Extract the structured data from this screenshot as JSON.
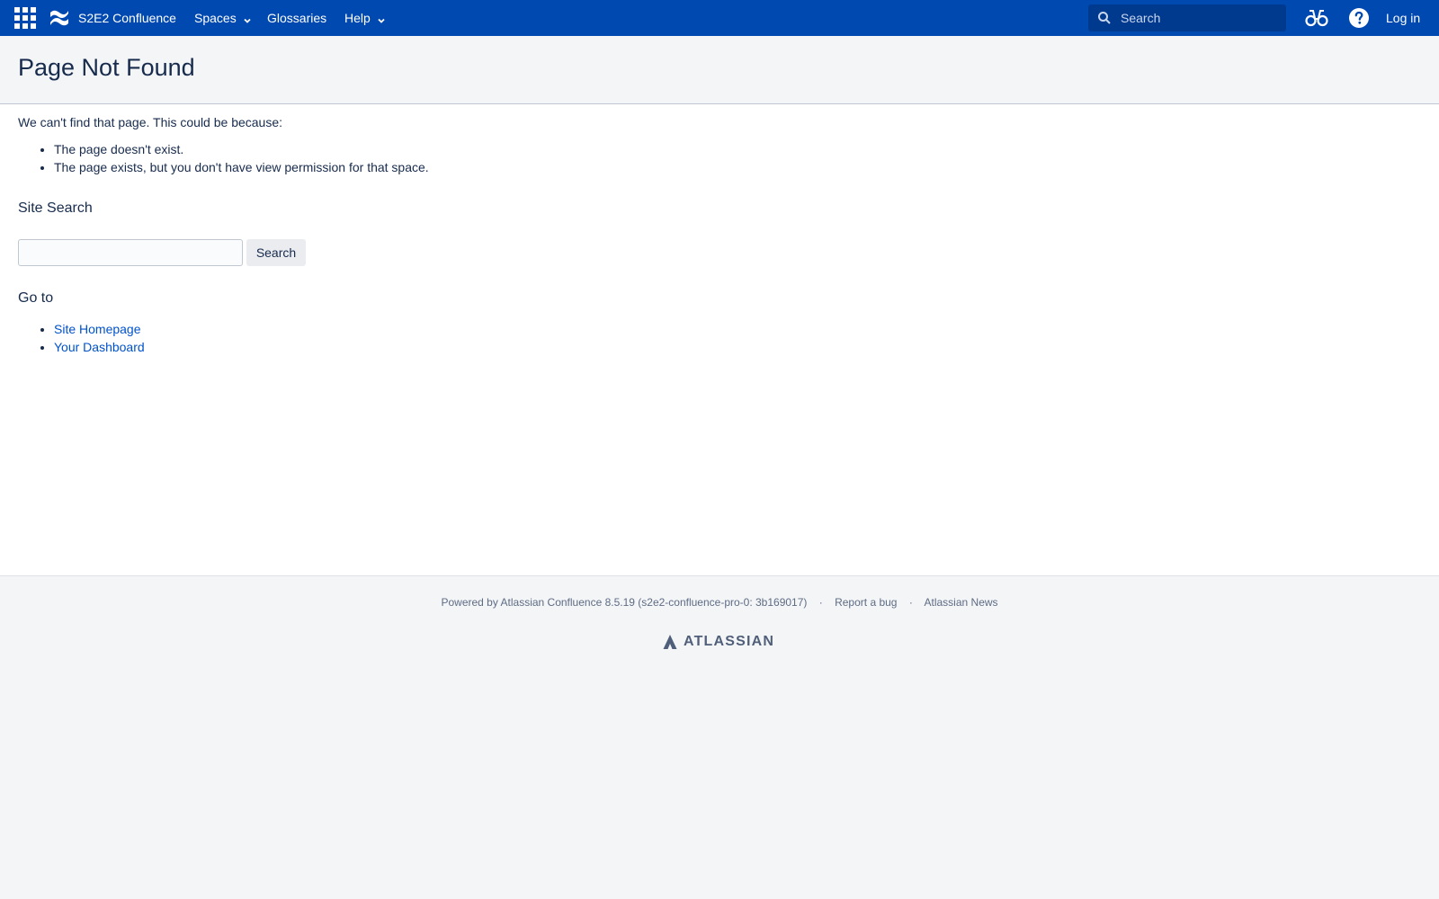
{
  "topbar": {
    "app_name": "S2E2 Confluence",
    "nav": [
      {
        "label": "Spaces",
        "icon": "chevron-down-icon"
      },
      {
        "label": "Glossaries"
      },
      {
        "label": "Help",
        "icon": "chevron-down-icon"
      }
    ],
    "search_placeholder": "Search",
    "login_label": "Log in",
    "icons": [
      "app-switcher-icon",
      "confluence-logo-icon",
      "search-icon",
      "binoculars-icon",
      "help-icon"
    ]
  },
  "page": {
    "title": "Page Not Found",
    "intro": "We can't find that page. This could be because:",
    "reasons": [
      "The page doesn't exist.",
      "The page exists, but you don't have view permission for that space."
    ],
    "site_search_heading": "Site Search",
    "search_button_label": "Search",
    "goto_heading": "Go to",
    "goto_links": [
      "Site Homepage",
      "Your Dashboard"
    ]
  },
  "footer": {
    "powered_by": "Powered by Atlassian Confluence 8.5.19 (s2e2-confluence-pro-0: 3b169017)",
    "links": [
      "Report a bug",
      "Atlassian News"
    ],
    "separator": "·",
    "brand": "ATLASSIAN"
  },
  "colors": {
    "header_bg": "#0049b0",
    "search_bg": "#003a8f",
    "link": "#0052cc",
    "text": "#172b4d",
    "page_bg": "#f4f5f7",
    "footer_text": "#5e6c84"
  }
}
